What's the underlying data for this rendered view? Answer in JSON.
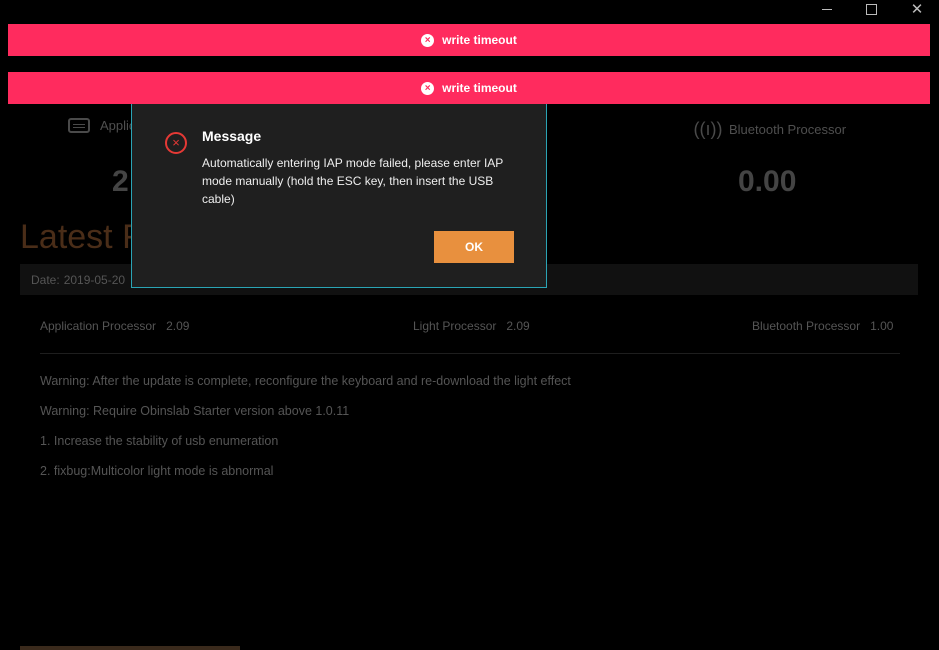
{
  "window": {
    "close_glyph": "✕"
  },
  "toasts": [
    {
      "text": "write timeout",
      "icon": "close-circle-icon"
    },
    {
      "text": "write timeout",
      "icon": "close-circle-icon"
    }
  ],
  "processors": [
    {
      "name": "Applic",
      "version": "2",
      "icon": "keyboard-icon"
    },
    {
      "name": "Bluetooth Processor",
      "version": "0.00",
      "icon": "antenna-icon"
    }
  ],
  "latest": {
    "title": "Latest F",
    "date_label": "Date:",
    "date_value": "2019-05-20",
    "versions": [
      {
        "label": "Application Processor",
        "value": "2.09"
      },
      {
        "label": "Light Processor",
        "value": "2.09"
      },
      {
        "label": "Bluetooth Processor",
        "value": "1.00"
      }
    ],
    "notes": [
      "Warning: After the update is complete, reconfigure the keyboard and re-download the light effect",
      "Warning: Require Obinslab Starter version above 1.0.11",
      "1. Increase the stability of usb enumeration",
      "2. fixbug:Multicolor light mode is abnormal"
    ]
  },
  "modal": {
    "title": "Message",
    "message": "Automatically entering IAP mode failed, please enter IAP mode manually (hold the ESC key, then insert the USB cable)",
    "ok_label": "OK",
    "icon": "error-circle-icon",
    "border_color": "#2aa4b5"
  },
  "colors": {
    "toast": "#ff2b5e",
    "accent": "#e8903e",
    "error": "#e53935"
  }
}
